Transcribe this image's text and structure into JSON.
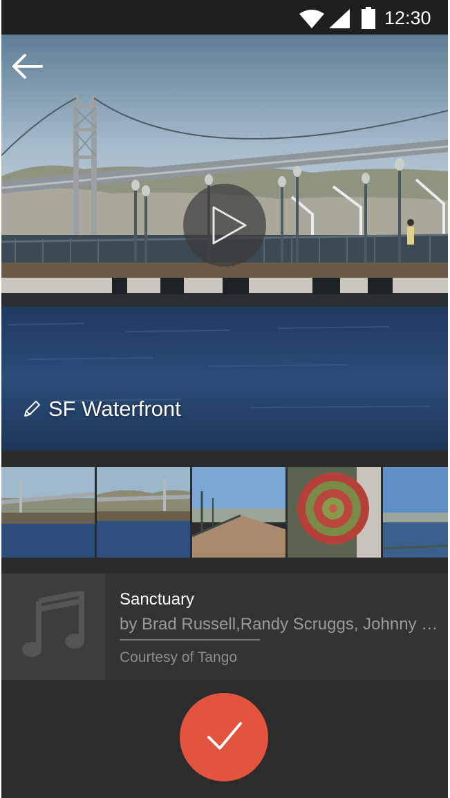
{
  "status_bar": {
    "time": "12:30",
    "icons": [
      "wifi-icon",
      "signal-icon",
      "battery-icon"
    ]
  },
  "hero": {
    "title": "SF Waterfront",
    "back_icon": "arrow-left-icon",
    "play_icon": "play-icon",
    "edit_icon": "pencil-icon"
  },
  "thumbnails": [
    {
      "subject": "bay bridge pier"
    },
    {
      "subject": "bay bridge wide"
    },
    {
      "subject": "pier walkway"
    },
    {
      "subject": "succulent plant"
    },
    {
      "subject": "waterfront city"
    }
  ],
  "music": {
    "title": "Sanctuary",
    "artist": "by Brad Russell,Randy Scruggs, Johnny Cash",
    "credit": "Courtesy of Tango",
    "art_icon": "music-note-icon"
  },
  "confirm": {
    "icon": "checkmark-icon"
  },
  "colors": {
    "accent": "#e2543d",
    "background": "#2c2c2c",
    "status_bar": "#1f1f1f"
  }
}
